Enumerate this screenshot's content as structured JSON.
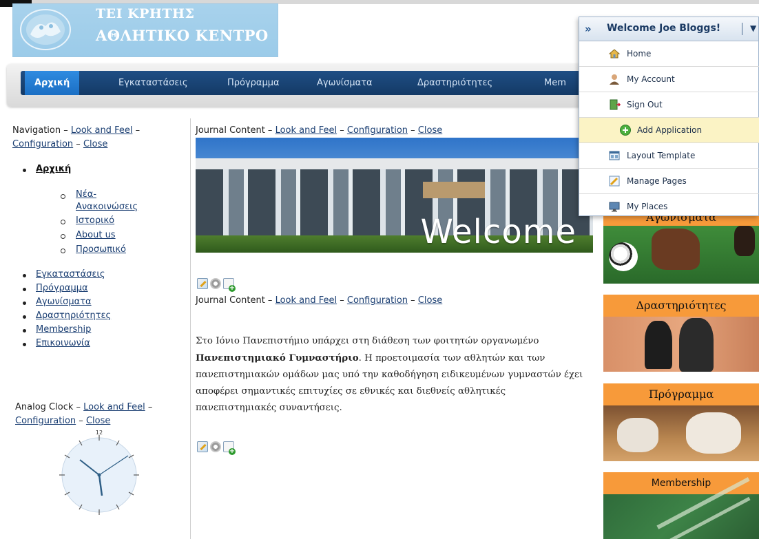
{
  "header": {
    "logo_line1": "ΤΕΙ ΚΡΗΤΗΣ",
    "logo_line2": "ΑΘΛΗΤΙΚΟ ΚΕΝΤΡΟ"
  },
  "nav": {
    "items": [
      {
        "label": "Αρχική",
        "active": true
      },
      {
        "label": "Εγκαταστάσεις"
      },
      {
        "label": "Πρόγραμμα"
      },
      {
        "label": "Αγωνίσματα"
      },
      {
        "label": "Δραστηριότητες"
      },
      {
        "label": "Mem"
      }
    ]
  },
  "left": {
    "navigation_portlet": {
      "title": "Navigation",
      "links": [
        "Look and Feel",
        "Configuration",
        "Close"
      ],
      "tree": {
        "home": "Αρχική",
        "sub": [
          "Νέα-",
          "Ανακοινώσεις",
          "Ιστορικό",
          "About us",
          "Προσωπικό"
        ],
        "main": [
          "Εγκαταστάσεις",
          "Πρόγραμμα",
          "Αγωνίσματα",
          "Δραστηριότητες",
          "Membership",
          "Επικοινωνία"
        ]
      }
    },
    "clock_portlet": {
      "title": "Analog Clock",
      "links": [
        "Look and Feel",
        "Configuration",
        "Close"
      ],
      "top_label": "12"
    }
  },
  "center": {
    "journal1": {
      "title": "Journal Content",
      "links": [
        "Look and Feel",
        "Configuration",
        "Close"
      ],
      "banner_text": "Welcome"
    },
    "journal2": {
      "title": "Journal Content",
      "links": [
        "Look and Feel",
        "Configuration",
        "Close"
      ],
      "article_p1": "Στο Ιόνιο Πανεπιστήμιο υπάρχει στη διάθεση των φοιτητών οργανωμένο",
      "article_bold": "Πανεπιστημιακό Γυμναστήριο",
      "article_p2": ". Η προετοιμασία των αθλητών και των πανεπιστημιακών ομάδων μας υπό την καθοδήγηση ειδικευμένων γυμναστών έχει αποφέρει σημαντικές επιτυχίες σε εθνικές και διεθνείς αθλητικές πανεπιστημιακές συναντήσεις."
    }
  },
  "right": {
    "blocks": [
      {
        "title": "Αγωνισματα"
      },
      {
        "title": "Δραστηριότητες"
      },
      {
        "title": "Πρόγραμμα"
      },
      {
        "title": "Membership"
      }
    ]
  },
  "dock": {
    "welcome": "Welcome Joe Bloggs!",
    "items": [
      {
        "label": "Home",
        "icon": "home-icon"
      },
      {
        "label": "My Account",
        "icon": "user-icon"
      },
      {
        "label": "Sign Out",
        "icon": "door-icon"
      },
      {
        "label": "Add Application",
        "icon": "plus-circle-icon"
      },
      {
        "label": "Layout Template",
        "icon": "layout-icon"
      },
      {
        "label": "Manage Pages",
        "icon": "pages-icon"
      },
      {
        "label": "My Places",
        "icon": "monitor-icon"
      }
    ]
  },
  "colors": {
    "nav_bg": "#1f4e84",
    "nav_active": "#2f8be0",
    "orange_header": "#f79a3a",
    "link": "#1a3e72",
    "dock_highlight": "#fbf3c5"
  }
}
